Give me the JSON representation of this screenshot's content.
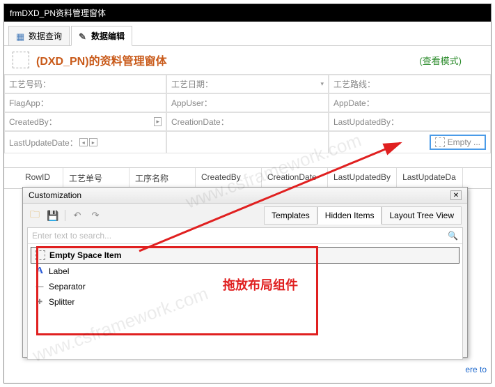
{
  "window": {
    "title": "frmDXD_PN资料管理窗体"
  },
  "tabs": {
    "query": "数据查询",
    "edit": "数据编辑"
  },
  "form": {
    "title": "(DXD_PN)的资料管理窗体",
    "mode": "(查看模式)",
    "fields": {
      "process_no": "工艺号码：",
      "process_date": "工艺日期：",
      "process_route": "工艺路线：",
      "flag_app": "FlagApp：",
      "app_user": "AppUser：",
      "app_date": "AppDate：",
      "created_by": "CreatedBy：",
      "creation_date": "CreationDate：",
      "last_updated_by": "LastUpdatedBy：",
      "last_update_date": "LastUpdateDate："
    },
    "empty_slot": "Empty ..."
  },
  "grid": {
    "columns": [
      "RowID",
      "工艺单号",
      "工序名称",
      "CreatedBy",
      "CreationDate",
      "LastUpdatedBy",
      "LastUpdateDa"
    ]
  },
  "customization": {
    "title": "Customization",
    "tabs": {
      "templates": "Templates",
      "hidden": "Hidden Items",
      "tree": "Layout Tree View"
    },
    "search_placeholder": "Enter text to search...",
    "items": {
      "empty": "Empty Space Item",
      "label": "Label",
      "separator": "Separator",
      "splitter": "Splitter"
    }
  },
  "annotation": "拖放布局组件",
  "footer": "ere to",
  "watermark": "www.csframework.com"
}
